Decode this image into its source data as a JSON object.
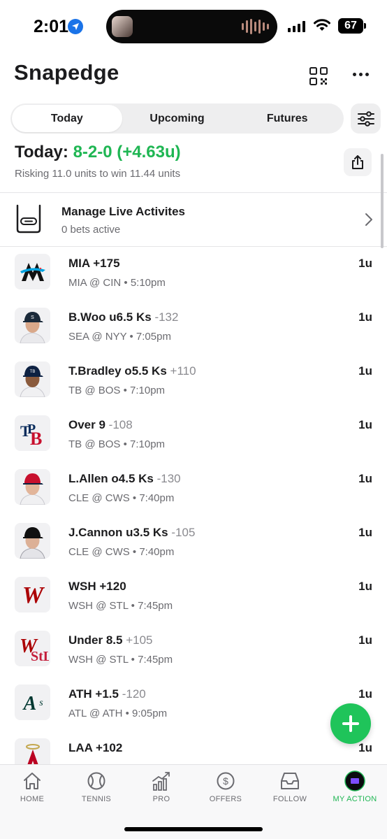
{
  "status": {
    "time": "2:01",
    "battery": "67"
  },
  "header": {
    "title": "Snapedge"
  },
  "tabs": [
    {
      "label": "Today",
      "active": true
    },
    {
      "label": "Upcoming",
      "active": false
    },
    {
      "label": "Futures",
      "active": false
    }
  ],
  "summary": {
    "label": "Today:",
    "record": "8-2-0 (+4.63u)",
    "subtitle": "Risking 11.0 units to win 11.44 units"
  },
  "live": {
    "title": "Manage Live Activites",
    "subtitle": "0 bets active"
  },
  "bets": [
    {
      "pick": "MIA +175",
      "odds": "",
      "matchup": "MIA @ CIN • 5:10pm",
      "units": "1u",
      "logo": "marlins-logo"
    },
    {
      "pick": "B.Woo u6.5 Ks",
      "odds": "-132",
      "matchup": "SEA @ NYY • 7:05pm",
      "units": "1u",
      "logo": "player-headshot"
    },
    {
      "pick": "T.Bradley o5.5 Ks",
      "odds": "+110",
      "matchup": "TB @ BOS • 7:10pm",
      "units": "1u",
      "logo": "player-headshot"
    },
    {
      "pick": "Over 9",
      "odds": "-108",
      "matchup": "TB @ BOS • 7:10pm",
      "units": "1u",
      "logo": "rays-logo"
    },
    {
      "pick": "L.Allen o4.5 Ks",
      "odds": "-130",
      "matchup": "CLE @ CWS • 7:40pm",
      "units": "1u",
      "logo": "player-headshot"
    },
    {
      "pick": "J.Cannon u3.5 Ks",
      "odds": "-105",
      "matchup": "CLE @ CWS • 7:40pm",
      "units": "1u",
      "logo": "player-headshot"
    },
    {
      "pick": "WSH +120",
      "odds": "",
      "matchup": "WSH @ STL • 7:45pm",
      "units": "1u",
      "logo": "nationals-logo"
    },
    {
      "pick": "Under 8.5",
      "odds": "+105",
      "matchup": "WSH @ STL • 7:45pm",
      "units": "1u",
      "logo": "nationals-cardinals-logo"
    },
    {
      "pick": "ATH +1.5",
      "odds": "-120",
      "matchup": "ATL @ ATH • 9:05pm",
      "units": "1u",
      "logo": "athletics-logo"
    },
    {
      "pick": "LAA +102",
      "odds": "",
      "matchup": "",
      "units": "1u",
      "logo": "angels-logo"
    }
  ],
  "tab_bar": [
    {
      "label": "HOME",
      "icon": "home-icon"
    },
    {
      "label": "TENNIS",
      "icon": "tennis-ball-icon"
    },
    {
      "label": "PRO",
      "icon": "chart-trend-icon"
    },
    {
      "label": "OFFERS",
      "icon": "dollar-icon"
    },
    {
      "label": "FOLLOW",
      "icon": "inbox-icon"
    },
    {
      "label": "MY ACTION",
      "icon": "my-action-icon",
      "active": true
    }
  ],
  "colors": {
    "accent": "#1fb653",
    "fab": "#1fc45a"
  }
}
